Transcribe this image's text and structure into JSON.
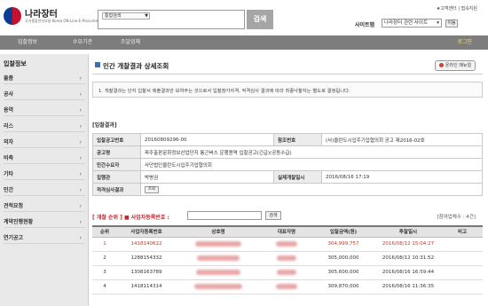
{
  "header": {
    "logo_title": "나라장터",
    "logo_sub": "국가종합전자조달 Korea ON-Line E-Procurement System",
    "search_select": "통합검색",
    "search_button": "검색",
    "top_links": "★고객센터 | 접속지원",
    "sitemap_label": "사이트맵",
    "sitemap_select": "나라장터 관련 사이트",
    "go_button": "이동"
  },
  "nav": {
    "items": [
      "입찰정보",
      "수요기관",
      "조달업체"
    ],
    "login": "로그인"
  },
  "sidebar": {
    "title": "입찰정보",
    "items": [
      "물품",
      "공사",
      "용역",
      "리스",
      "외자",
      "비축",
      "기타",
      "민간",
      "견적요청",
      "계약진행현황",
      "연기공고"
    ]
  },
  "main": {
    "title": "민간 개찰결과 상세조회",
    "online_button": "온라인 매뉴얼",
    "notice": "1. 개찰결과는 단지 입찰서 제출결과만 보여주는 것으로서 입찰참가자격, 적격심사 결과에 따라 최종낙찰자는 별도로 결정됩니다.",
    "section_title": "[입찰결과]",
    "info": {
      "announce_no_label": "입찰공고번호",
      "announce_no": "20160809296-00",
      "ref_no_label": "참조번호",
      "ref_no": "(사)울란도시입주기업협의회 공고 제2016-02호",
      "name_label": "공고명",
      "name": "파주출판문화정보산업단지 통근버스 운행용역 입찰공고(긴급)(공동수급)",
      "client_label": "민간수요자",
      "client": "사단법인울란도시입주기업협의회",
      "officer_label": "집행관",
      "officer": "박병권",
      "open_time_label": "실제개찰일시",
      "open_time": "2016/08/16 17:19",
      "review_label": "적격심사결과",
      "review_button": "조회"
    },
    "filter": {
      "rank_label": "[ 개찰 순위 ]",
      "reg_label": "■ 사업자등록번호 :",
      "search_button": "검색",
      "count": "[참여업체수 : 4건]"
    },
    "table": {
      "headers": [
        "순위",
        "사업자등록번호",
        "상호명",
        "대표자명",
        "입찰금액(원)",
        "투찰일시",
        "비고"
      ],
      "rows": [
        {
          "rank": "1",
          "reg": "1418140622",
          "amount": "304,999,757",
          "time": "2016/08/12 15:04:27",
          "note": ""
        },
        {
          "rank": "2",
          "reg": "1288154332",
          "amount": "305,000,000",
          "time": "2016/08/12 10:31:52",
          "note": ""
        },
        {
          "rank": "3",
          "reg": "1308163789",
          "amount": "305,600,000",
          "time": "2016/08/16 16:59:44",
          "note": ""
        },
        {
          "rank": "4",
          "reg": "1418114314",
          "amount": "309,870,000",
          "time": "2016/08/16 11:36:35",
          "note": ""
        }
      ]
    }
  },
  "colors": {
    "accent_red": "#c1272d",
    "nav_gray": "#7d7d7d",
    "login_yellow": "#f6e27a"
  }
}
